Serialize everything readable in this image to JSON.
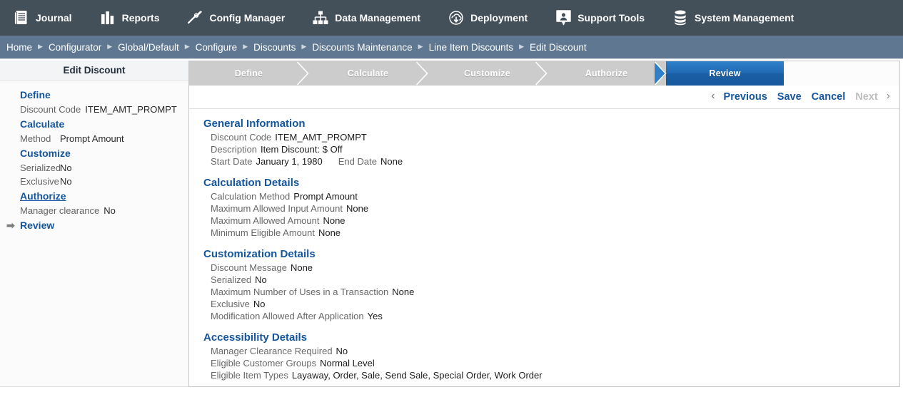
{
  "topnav": {
    "items": [
      {
        "label": "Journal",
        "icon": "journal-icon"
      },
      {
        "label": "Reports",
        "icon": "bar-chart-icon"
      },
      {
        "label": "Config Manager",
        "icon": "wrench-icon"
      },
      {
        "label": "Data Management",
        "icon": "hierarchy-icon"
      },
      {
        "label": "Deployment",
        "icon": "cloud-download-icon"
      },
      {
        "label": "Support Tools",
        "icon": "person-bubble-icon"
      },
      {
        "label": "System Management",
        "icon": "database-icon"
      }
    ]
  },
  "breadcrumb": {
    "items": [
      "Home",
      "Configurator",
      "Global/Default",
      "Configure",
      "Discounts",
      "Discounts Maintenance",
      "Line Item Discounts",
      "Edit Discount"
    ],
    "separator": "▶"
  },
  "sidebar": {
    "title": "Edit Discount",
    "steps": [
      {
        "label": "Define",
        "underlined": false,
        "current": false,
        "fields": [
          {
            "label": "Discount Code",
            "value": "ITEM_AMT_PROMPT",
            "aligned": false
          }
        ]
      },
      {
        "label": "Calculate",
        "underlined": false,
        "current": false,
        "fields": [
          {
            "label": "Method",
            "value": "Prompt Amount",
            "aligned": true
          }
        ]
      },
      {
        "label": "Customize",
        "underlined": false,
        "current": false,
        "fields": [
          {
            "label": "Serialized",
            "value": "No",
            "aligned": true
          },
          {
            "label": "Exclusive",
            "value": "No",
            "aligned": true
          }
        ]
      },
      {
        "label": "Authorize",
        "underlined": true,
        "current": false,
        "fields": [
          {
            "label": "Manager clearance",
            "value": "No",
            "aligned": false
          }
        ]
      },
      {
        "label": "Review",
        "underlined": false,
        "current": true,
        "current_marker": "➡",
        "fields": []
      }
    ]
  },
  "wizard": {
    "steps": [
      {
        "label": "Define",
        "active": false
      },
      {
        "label": "Calculate",
        "active": false
      },
      {
        "label": "Customize",
        "active": false
      },
      {
        "label": "Authorize",
        "active": false
      },
      {
        "label": "Review",
        "active": true
      }
    ]
  },
  "actions": {
    "prev_chevron": "‹",
    "previous": "Previous",
    "save": "Save",
    "cancel": "Cancel",
    "next": "Next",
    "next_chevron": "›"
  },
  "review": {
    "sections": [
      {
        "title": "General Information",
        "rows": [
          {
            "label": "Discount Code",
            "value": "ITEM_AMT_PROMPT"
          },
          {
            "label": "Description",
            "value": "Item Discount: $ Off"
          },
          {
            "label": "Start Date",
            "value": "January 1, 1980",
            "label2": "End Date",
            "value2": "None"
          }
        ]
      },
      {
        "title": "Calculation Details",
        "rows": [
          {
            "label": "Calculation Method",
            "value": "Prompt Amount"
          },
          {
            "label": "Maximum Allowed Input Amount",
            "value": "None"
          },
          {
            "label": "Maximum Allowed Amount",
            "value": "None"
          },
          {
            "label": "Minimum Eligible Amount",
            "value": "None"
          }
        ]
      },
      {
        "title": "Customization Details",
        "rows": [
          {
            "label": "Discount Message",
            "value": "None"
          },
          {
            "label": "Serialized",
            "value": "No"
          },
          {
            "label": "Maximum Number of Uses in a Transaction",
            "value": "None"
          },
          {
            "label": "Exclusive",
            "value": "No"
          },
          {
            "label": "Modification Allowed After Application",
            "value": "Yes"
          }
        ]
      },
      {
        "title": "Accessibility Details",
        "rows": [
          {
            "label": "Manager Clearance Required",
            "value": "No"
          },
          {
            "label": "Eligible Customer Groups",
            "value": "Normal Level"
          },
          {
            "label": "Eligible Item Types",
            "value": "Layaway, Order, Sale, Send Sale, Special Order, Work Order"
          }
        ]
      }
    ]
  },
  "colors": {
    "topnav_bg": "#434f59",
    "breadcrumb_bg": "#5f7790",
    "accent_blue": "#14569e",
    "wizard_inactive": "#cccccc",
    "wizard_active": "#1f6ab3"
  }
}
